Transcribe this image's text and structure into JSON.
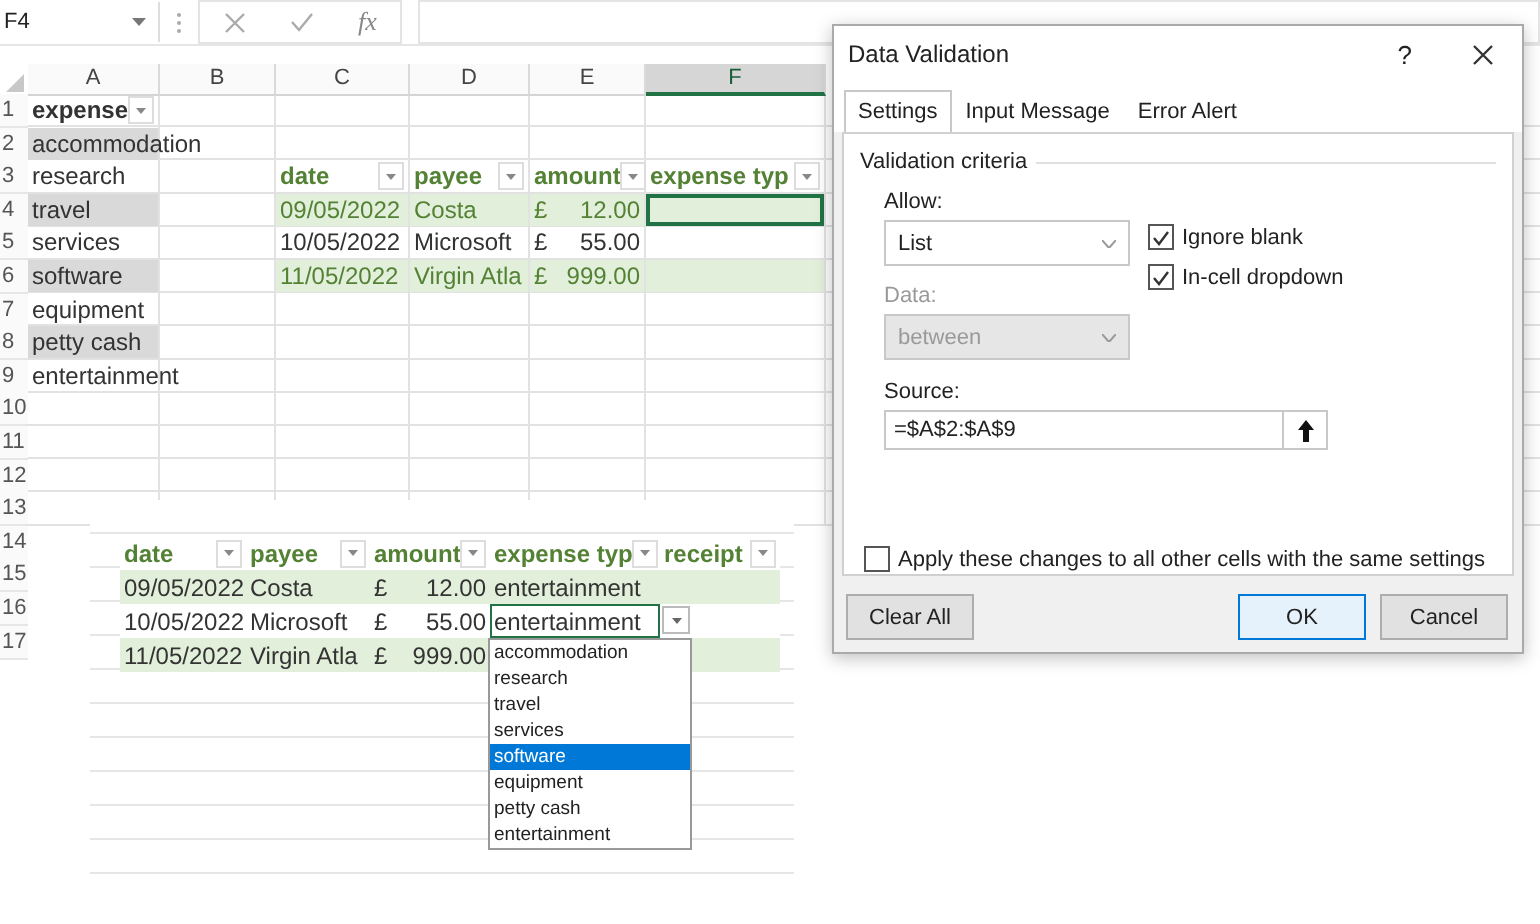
{
  "formula_bar": {
    "name_box": "F4",
    "fx_label": "fx"
  },
  "sheet": {
    "columns": [
      {
        "label": "A",
        "selected": false
      },
      {
        "label": "B",
        "selected": false
      },
      {
        "label": "C",
        "selected": false
      },
      {
        "label": "D",
        "selected": false
      },
      {
        "label": "E",
        "selected": false
      },
      {
        "label": "F",
        "selected": true
      }
    ],
    "row_numbers": [
      "1",
      "2",
      "3",
      "4",
      "5",
      "6",
      "7",
      "8",
      "9",
      "10",
      "11",
      "12",
      "13",
      "14",
      "15",
      "16",
      "17"
    ],
    "expenses_table": {
      "header": "expense",
      "items": [
        {
          "text": "accommodation",
          "banded": true
        },
        {
          "text": "research",
          "banded": false
        },
        {
          "text": "travel",
          "banded": true
        },
        {
          "text": "services",
          "banded": false
        },
        {
          "text": "software",
          "banded": true
        },
        {
          "text": "equipment",
          "banded": false
        },
        {
          "text": "petty cash",
          "banded": true
        },
        {
          "text": "entertainment",
          "banded": false
        }
      ]
    },
    "expense_table": {
      "columns": [
        "date",
        "payee",
        "amount",
        "expense typ"
      ],
      "rows": [
        {
          "date": "09/05/2022",
          "payee": "Costa",
          "currency": "£",
          "amount": "12.00",
          "banded": true,
          "selected": true
        },
        {
          "date": "10/05/2022",
          "payee": "Microsoft",
          "currency": "£",
          "amount": "55.00",
          "banded": false,
          "selected": false
        },
        {
          "date": "11/05/2022",
          "payee": "Virgin Atla",
          "currency": "£",
          "amount": "999.00",
          "banded": true,
          "selected": false
        }
      ]
    }
  },
  "inset_view": {
    "columns": [
      "date",
      "payee",
      "amount",
      "expense typ",
      "receipt"
    ],
    "rows": [
      {
        "date": "09/05/2022",
        "payee": "Costa",
        "currency": "£",
        "amount": "12.00",
        "expense_type": "entertainment",
        "banded": true,
        "selected": false
      },
      {
        "date": "10/05/2022",
        "payee": "Microsoft",
        "currency": "£",
        "amount": "55.00",
        "expense_type": "entertainment",
        "banded": false,
        "selected": true
      },
      {
        "date": "11/05/2022",
        "payee": "Virgin Atla",
        "currency": "£",
        "amount": "999.00",
        "banded": true,
        "selected": false
      }
    ],
    "dropdown": {
      "items": [
        {
          "text": "accommodation",
          "selected": false
        },
        {
          "text": "research",
          "selected": false
        },
        {
          "text": "travel",
          "selected": false
        },
        {
          "text": "services",
          "selected": false
        },
        {
          "text": "software",
          "selected": true
        },
        {
          "text": "equipment",
          "selected": false
        },
        {
          "text": "petty cash",
          "selected": false
        },
        {
          "text": "entertainment",
          "selected": false
        }
      ]
    }
  },
  "dialog": {
    "title": "Data Validation",
    "help": "?",
    "tabs": [
      {
        "label": "Settings",
        "selected": true
      },
      {
        "label": "Input Message",
        "selected": false
      },
      {
        "label": "Error Alert",
        "selected": false
      }
    ],
    "group_label": "Validation criteria",
    "allow_label": "Allow:",
    "allow_value": "List",
    "data_label": "Data:",
    "data_value": "between",
    "data_disabled": true,
    "options": [
      {
        "label": "Ignore blank",
        "checked": true
      },
      {
        "label": "In-cell dropdown",
        "checked": true
      }
    ],
    "source_label": "Source:",
    "source_value": "=$A$2:$A$9",
    "apply": {
      "label": "Apply these changes to all other cells with the same settings",
      "checked": false
    },
    "buttons": [
      {
        "label": "Clear All",
        "kind": "secondary"
      },
      {
        "label": "OK",
        "kind": "default"
      },
      {
        "label": "Cancel",
        "kind": "secondary"
      }
    ]
  }
}
